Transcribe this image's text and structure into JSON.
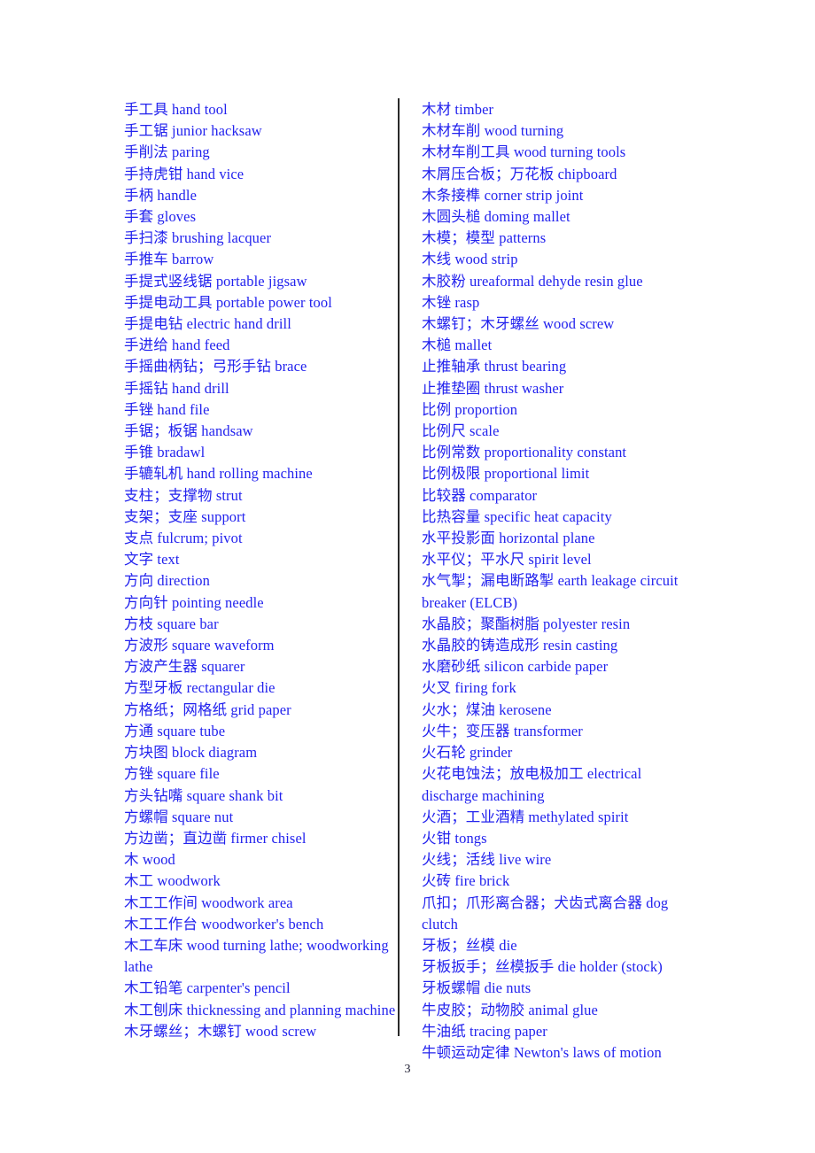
{
  "document": {
    "type": "bilingual-glossary",
    "page_number": "3",
    "text_color": "#2222ee",
    "divider_color": "#2a2a2a",
    "page_number_color": "#1a1a2e"
  },
  "columns": {
    "left": [
      "手工具  hand tool",
      "手工锯  junior hacksaw",
      "手削法  paring",
      "手持虎钳  hand vice",
      "手柄  handle",
      "手套  gloves",
      "手扫漆  brushing lacquer",
      "手推车  barrow",
      "手提式竖线锯  portable jigsaw",
      "手提电动工具  portable power tool",
      "手提电钻  electric hand drill",
      "手进给  hand feed",
      "手摇曲柄钻；弓形手钻  brace",
      "手摇钻  hand drill",
      "手锉  hand file",
      "手锯；板锯  handsaw",
      "手锥  bradawl",
      "手辘轧机  hand rolling machine",
      "支柱；支撑物  strut",
      "支架；支座  support",
      "支点  fulcrum; pivot",
      "文字  text",
      "方向  direction",
      "方向针  pointing needle",
      "方枝  square bar",
      "方波形  square waveform",
      "方波产生器  squarer",
      "方型牙板  rectangular die",
      "方格纸；网格纸  grid paper",
      "方通  square tube",
      "方块图  block diagram",
      "方锉  square file",
      "方头钻嘴  square shank bit",
      "方螺帽  square nut",
      "方边凿；直边凿  firmer chisel",
      "木  wood",
      "木工  woodwork",
      "木工工作间  woodwork area",
      "木工工作台  woodworker's bench",
      "木工车床  wood turning lathe; woodworking lathe",
      "木工铅笔  carpenter's pencil",
      "木工刨床  thicknessing and planning machine",
      "木牙螺丝；木螺钉  wood screw"
    ],
    "right": [
      "木材  timber",
      "木材车削  wood turning",
      "木材车削工具  wood turning tools",
      "木屑压合板；万花板  chipboard",
      "木条接榫  corner strip joint",
      "木圆头槌  doming mallet",
      "木模；模型  patterns",
      "木线  wood strip",
      "木胶粉  ureaformal dehyde resin glue",
      "木锉  rasp",
      "木螺钉；木牙螺丝  wood screw",
      "木槌  mallet",
      "止推轴承  thrust bearing",
      "止推垫圈  thrust washer",
      "比例  proportion",
      "比例尺  scale",
      "比例常数  proportionality constant",
      "比例极限  proportional limit",
      "比较器  comparator",
      "比热容量  specific heat capacity",
      "水平投影面  horizontal plane",
      "水平仪；平水尺  spirit level",
      "水气掣；漏电断路掣  earth leakage circuit breaker (ELCB)",
      "水晶胶；聚酯树脂  polyester resin",
      "水晶胶的铸造成形  resin casting",
      "水磨砂纸  silicon carbide paper",
      "火叉  firing fork",
      "火水；煤油  kerosene",
      "火牛；变压器  transformer",
      "火石轮  grinder",
      "火花电蚀法；放电极加工  electrical discharge machining",
      "火酒；工业酒精  methylated spirit",
      "火钳  tongs",
      "火线；活线  live wire",
      "火砖  fire brick",
      "爪扣；爪形离合器；犬齿式离合器  dog clutch",
      "牙板；丝模  die",
      "牙板扳手；丝模扳手  die holder (stock)",
      "牙板螺帽  die nuts",
      "牛皮胶；动物胶  animal glue",
      "牛油纸  tracing paper",
      "牛顿运动定律  Newton's laws of motion"
    ]
  }
}
